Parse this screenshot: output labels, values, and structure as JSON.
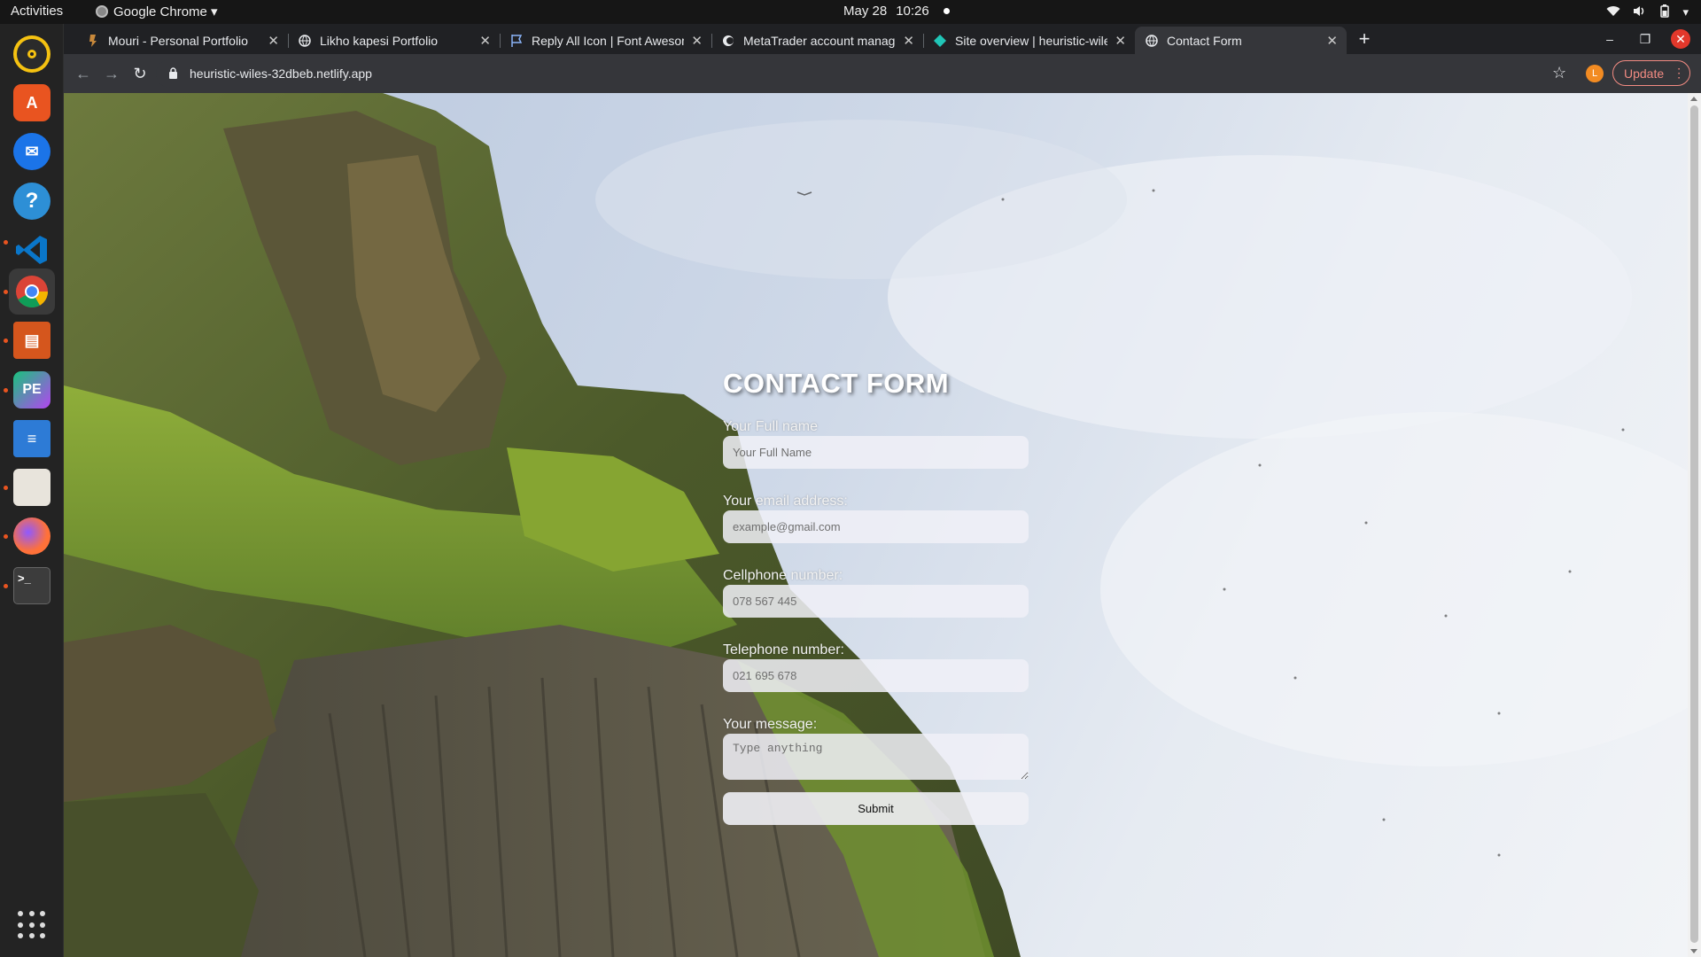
{
  "system": {
    "activities_label": "Activities",
    "app_menu_label": "Google Chrome ▾",
    "date": "May 28",
    "time": "10:26"
  },
  "dock": {
    "items": [
      {
        "name": "rhythmbox",
        "color": "#f5c211",
        "glyph": "◉"
      },
      {
        "name": "ubuntu-software",
        "color": "#e95420",
        "glyph": "A"
      },
      {
        "name": "thunderbird",
        "color": "#1b74e8",
        "glyph": "✉"
      },
      {
        "name": "help",
        "color": "#2d8fd6",
        "glyph": "?"
      },
      {
        "name": "vscode",
        "color": "#0a76c9",
        "glyph": "❯"
      },
      {
        "name": "chrome",
        "color": "#f2f2f2",
        "glyph": "◎"
      },
      {
        "name": "impress",
        "color": "#d5561d",
        "glyph": "▤"
      },
      {
        "name": "phpstorm",
        "color": "#19c37d",
        "glyph": "PE"
      },
      {
        "name": "writer",
        "color": "#2d7bd6",
        "glyph": "≡"
      },
      {
        "name": "files",
        "color": "#e8e4dc",
        "glyph": ""
      },
      {
        "name": "firefox",
        "color": "#ff7139",
        "glyph": "◐"
      },
      {
        "name": "terminal",
        "color": "#3c3c3c",
        "glyph": ">_"
      }
    ]
  },
  "browser": {
    "tabs": [
      {
        "title": "Mouri - Personal Portfolio",
        "favicon": "portfolio-icon"
      },
      {
        "title": "Likho kapesi Portfolio",
        "favicon": "globe-icon"
      },
      {
        "title": "Reply All Icon | Font Awesome",
        "favicon": "flag-icon"
      },
      {
        "title": "MetaTrader account manager",
        "favicon": "metatrader-icon"
      },
      {
        "title": "Site overview | heuristic-wiles",
        "favicon": "netlify-icon"
      },
      {
        "title": "Contact Form",
        "favicon": "globe-icon"
      }
    ],
    "url": "heuristic-wiles-32dbeb.netlify.app",
    "profile_initial": "L",
    "update_label": "Update"
  },
  "page": {
    "heading": "CONTACT FORM",
    "fields": {
      "name": {
        "label": "Your Full name",
        "placeholder": "Your Full Name"
      },
      "email": {
        "label": "Your email address:",
        "placeholder": "example@gmail.com"
      },
      "cellphone": {
        "label": "Cellphone number:",
        "placeholder": "078 567 445"
      },
      "telephone": {
        "label": "Telephone number:",
        "placeholder": "021 695 678"
      },
      "message": {
        "label": "Your message:",
        "placeholder": "Type anything"
      }
    },
    "submit_label": "Submit"
  }
}
